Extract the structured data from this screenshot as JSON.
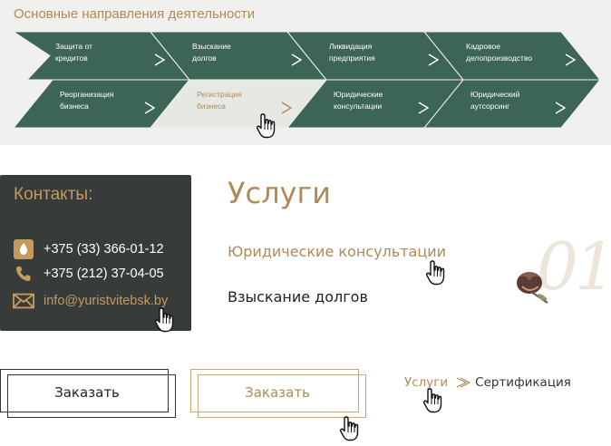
{
  "banner": {
    "title": "Основные направления деятельности",
    "colors": {
      "green": "#3c6555",
      "light": "#e6e8e4",
      "accent": "#b08a59"
    },
    "row1": [
      {
        "label": "Защита от\nкредитов",
        "state": "normal"
      },
      {
        "label": "Взыскание\nдолгов",
        "state": "normal"
      },
      {
        "label": "Ликвидация\nпредприятия",
        "state": "normal"
      },
      {
        "label": "Кадровое\nделопроизводство",
        "state": "normal"
      }
    ],
    "row2": [
      {
        "label": "Реорганизация\nбизнеса",
        "state": "normal"
      },
      {
        "label": "Регистрация\nбизнеса",
        "state": "hover"
      },
      {
        "label": "Юридические\nконсультации",
        "state": "normal"
      },
      {
        "label": "Юридический\nаутсорсинг",
        "state": "normal"
      }
    ],
    "arrow_icon": "chevron-right-icon"
  },
  "contacts": {
    "title": "Контакты:",
    "phone_1": "+375 (33) 366-01-12",
    "phone_2": "+375 (212) 37-04-05",
    "email": "info@yuristvitebsk.by",
    "icons": [
      "mts-operator-icon",
      "phone-icon",
      "envelope-icon"
    ]
  },
  "services": {
    "title": "Услуги",
    "items": [
      "Юридические консультации",
      "Взыскание долгов"
    ],
    "number": "01",
    "decor_icon": "dried-flower-icon"
  },
  "buttons": {
    "order_dark": "Заказать",
    "order_gold": "Заказать"
  },
  "breadcrumb": {
    "link": "Услуги",
    "separator_icon": "chevron-right-icon",
    "current": "Сертификация"
  },
  "cursor_icon": "hand-pointer-icon"
}
